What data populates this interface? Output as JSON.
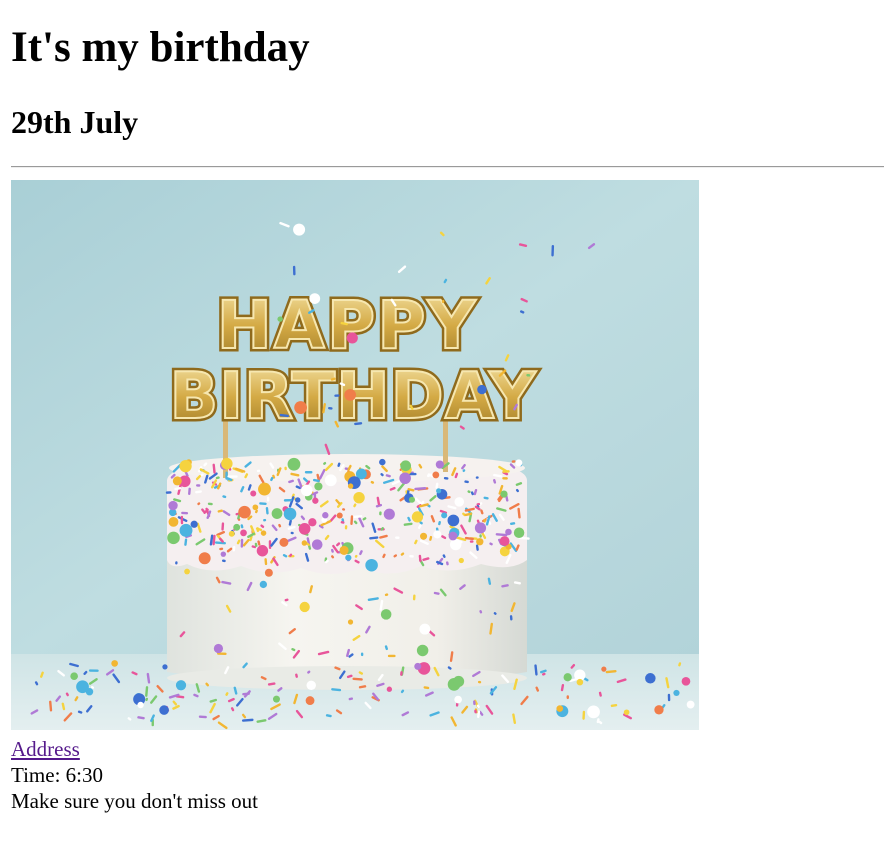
{
  "page": {
    "title": "It's my birthday",
    "date": "29th July"
  },
  "image": {
    "topper_line1": "HAPPY",
    "topper_line2": "BIRTHDAY",
    "description": "birthday-cake-photo"
  },
  "details": {
    "address_link": "Address",
    "time": "Time: 6:30",
    "note": "Make sure you don't miss out"
  },
  "colors": {
    "link_visited": "#551a8b",
    "background_photo": "#b4d5da",
    "gold": "#d9b24e",
    "frosting": "#f3f1ec"
  }
}
